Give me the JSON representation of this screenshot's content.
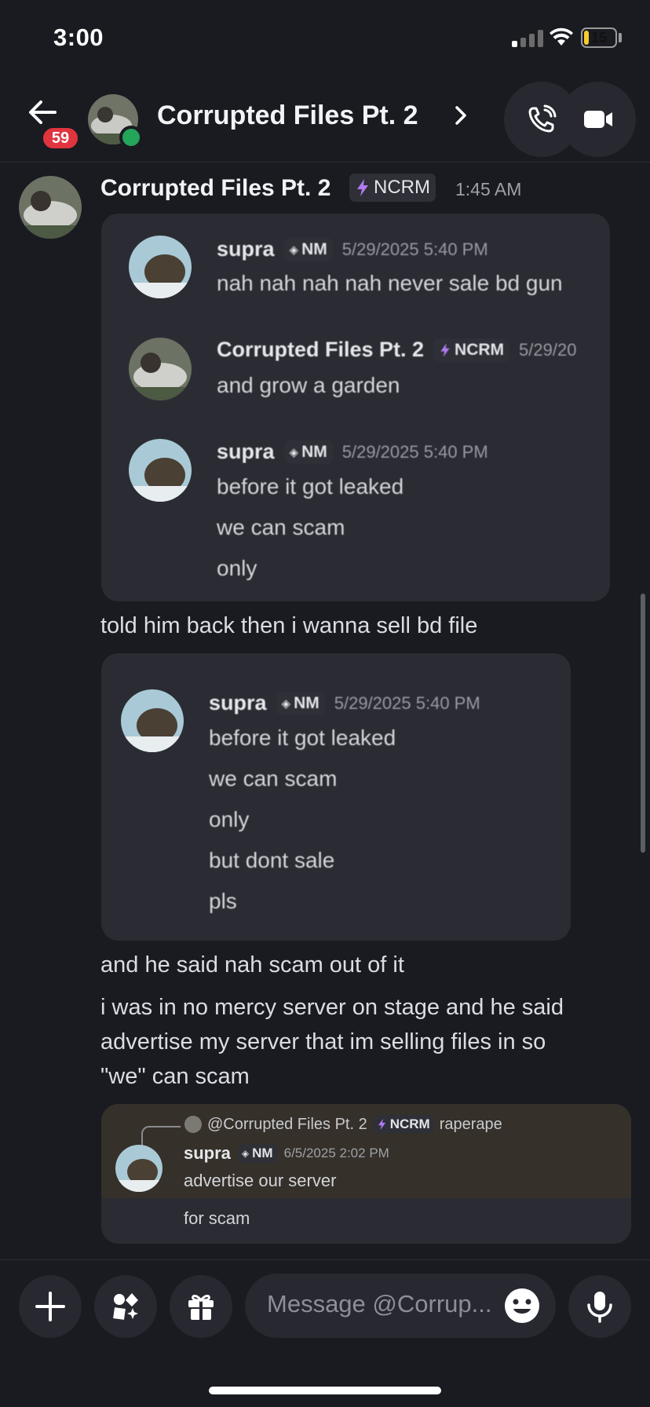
{
  "status_bar": {
    "time": "3:00",
    "battery": "15",
    "battery_level": 0.15
  },
  "header": {
    "back_icon": "arrow-left-icon",
    "unread_badge": "59",
    "title": "Corrupted Files Pt. 2",
    "call_icon": "phone-call-icon",
    "video_icon": "video-camera-icon"
  },
  "message": {
    "author": "Corrupted Files Pt. 2",
    "tag": "NCRM",
    "time": "1:45 AM",
    "quote1": [
      {
        "author": "supra",
        "tag": "NM",
        "time": "5/29/2025 5:40 PM",
        "lines": [
          "nah nah nah nah never sale bd gun"
        ]
      },
      {
        "author": "Corrupted Files Pt. 2",
        "tag": "NCRM",
        "time": "5/29/20",
        "lines": [
          "and grow a garden"
        ]
      },
      {
        "author": "supra",
        "tag": "NM",
        "time": "5/29/2025 5:40 PM",
        "lines": [
          "before it got leaked",
          "we can scam",
          "only"
        ]
      }
    ],
    "text1": "told him back then i wanna sell bd file",
    "quote2": {
      "author": "supra",
      "tag": "NM",
      "time": "5/29/2025 5:40 PM",
      "lines": [
        "before it got leaked",
        "we can scam",
        "only",
        "but dont sale",
        "pls"
      ]
    },
    "text2": "and he said nah scam out of it",
    "text3_lines": [
      "i was in no mercy server on stage and he said",
      "advertise my server that im selling files in so",
      "\"we\" can scam"
    ],
    "quote3": {
      "reply_author": "@Corrupted Files Pt. 2",
      "reply_tag": "NCRM",
      "reply_text": "raperape",
      "author": "supra",
      "tag": "NM",
      "time": "6/5/2025 2:02 PM",
      "lines": [
        "advertise our server",
        "for scam"
      ]
    }
  },
  "composer": {
    "placeholder": "Message @Corrup...",
    "icons": [
      "plus-icon",
      "apps-icon",
      "gift-icon",
      "emoji-icon",
      "microphone-icon"
    ]
  }
}
